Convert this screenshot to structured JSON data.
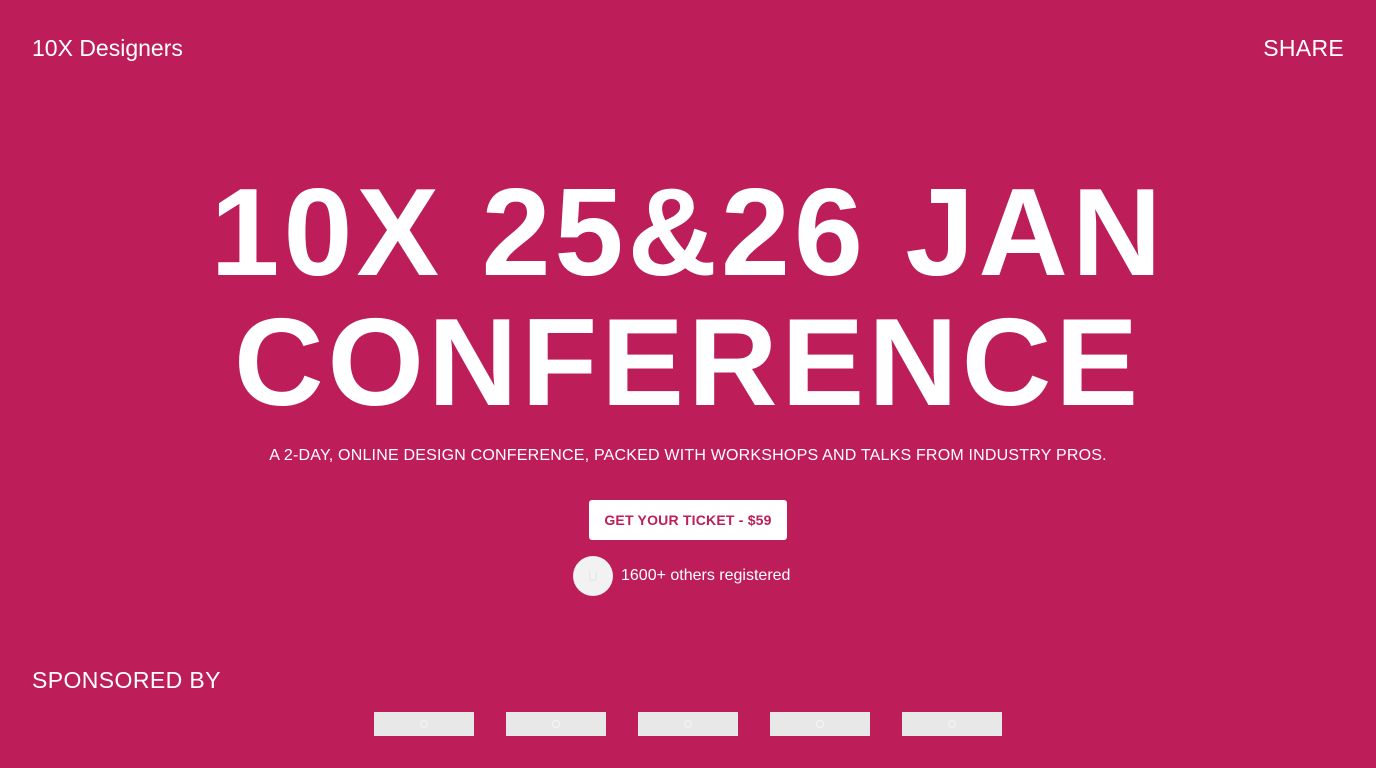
{
  "header": {
    "brand": "10X Designers",
    "share_label": "SHARE"
  },
  "hero": {
    "title_line1": "10X 25&26 JAN",
    "title_line2": "CONFERENCE",
    "tagline": "A 2-DAY, ONLINE DESIGN CONFERENCE, PACKED WITH WORKSHOPS AND TALKS FROM INDUSTRY PROS.",
    "cta_label": "GET YOUR TICKET - $59",
    "avatar_initial": "U",
    "registered_text": "1600+ others registered"
  },
  "sponsors": {
    "heading": "SPONSORED BY",
    "logos": [
      {
        "icon": "image-placeholder-icon"
      },
      {
        "icon": "image-placeholder-icon"
      },
      {
        "icon": "image-placeholder-icon"
      },
      {
        "icon": "image-placeholder-icon"
      },
      {
        "icon": "image-placeholder-icon"
      }
    ]
  },
  "colors": {
    "background": "#bd1d58",
    "text": "#ffffff",
    "button_background": "#ffffff",
    "button_text": "#bd1d58",
    "placeholder": "#e8e8e8"
  }
}
